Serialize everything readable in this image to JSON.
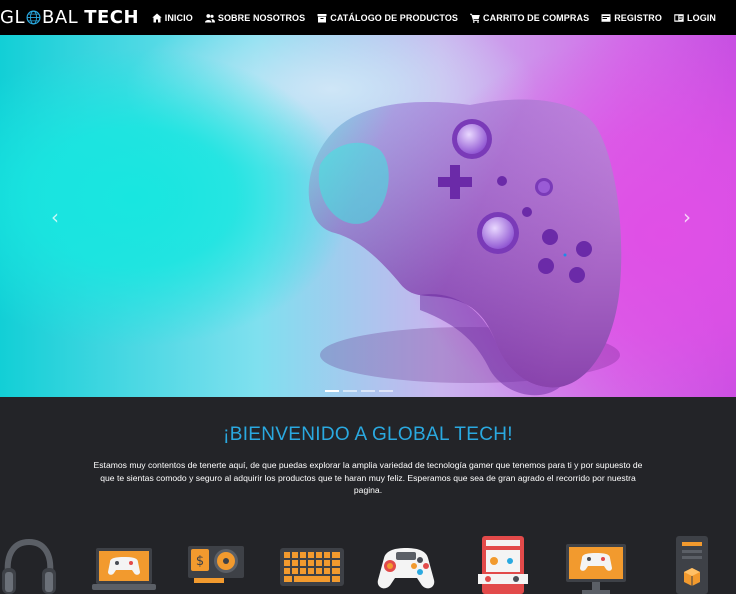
{
  "brand": {
    "part1": "GL",
    "part2": "BAL",
    "part3": "TECH"
  },
  "nav": {
    "items": [
      {
        "label": "INICIO",
        "icon": "home-icon"
      },
      {
        "label": "SOBRE NOSOTROS",
        "icon": "users-icon"
      },
      {
        "label": "CATÁLOGO DE PRODUCTOS",
        "icon": "catalog-icon"
      },
      {
        "label": "CARRITO DE COMPRAS",
        "icon": "cart-icon"
      },
      {
        "label": "REGISTRO",
        "icon": "register-icon"
      },
      {
        "label": "LOGIN",
        "icon": "login-icon"
      }
    ]
  },
  "carousel": {
    "prev": "‹",
    "next": "›",
    "slides": 4,
    "active_slide": 1,
    "image": "game-controller-image"
  },
  "welcome": {
    "title": "¡BIENVENIDO A GLOBAL TECH!",
    "text": "Estamos muy contentos de tenerte aquí, de que puedas explorar la amplia variedad de tecnología gamer que tenemos para ti y por supuesto de que te sientas comodo y seguro al adquirir los productos que te haran muy feliz. Esperamos que sea de gran agrado el recorrido por nuestra pagina."
  },
  "product_icons": [
    "headset-icon",
    "laptop-gamepad-icon",
    "graphics-card-icon",
    "keyboard-icon",
    "gamepad-icon",
    "arcade-machine-icon",
    "monitor-gamepad-icon",
    "pc-tower-icon"
  ],
  "colors": {
    "nav_bg": "#000000",
    "page_bg": "#232428",
    "title": "#2aa9e0",
    "orange": "#f29a2e"
  }
}
